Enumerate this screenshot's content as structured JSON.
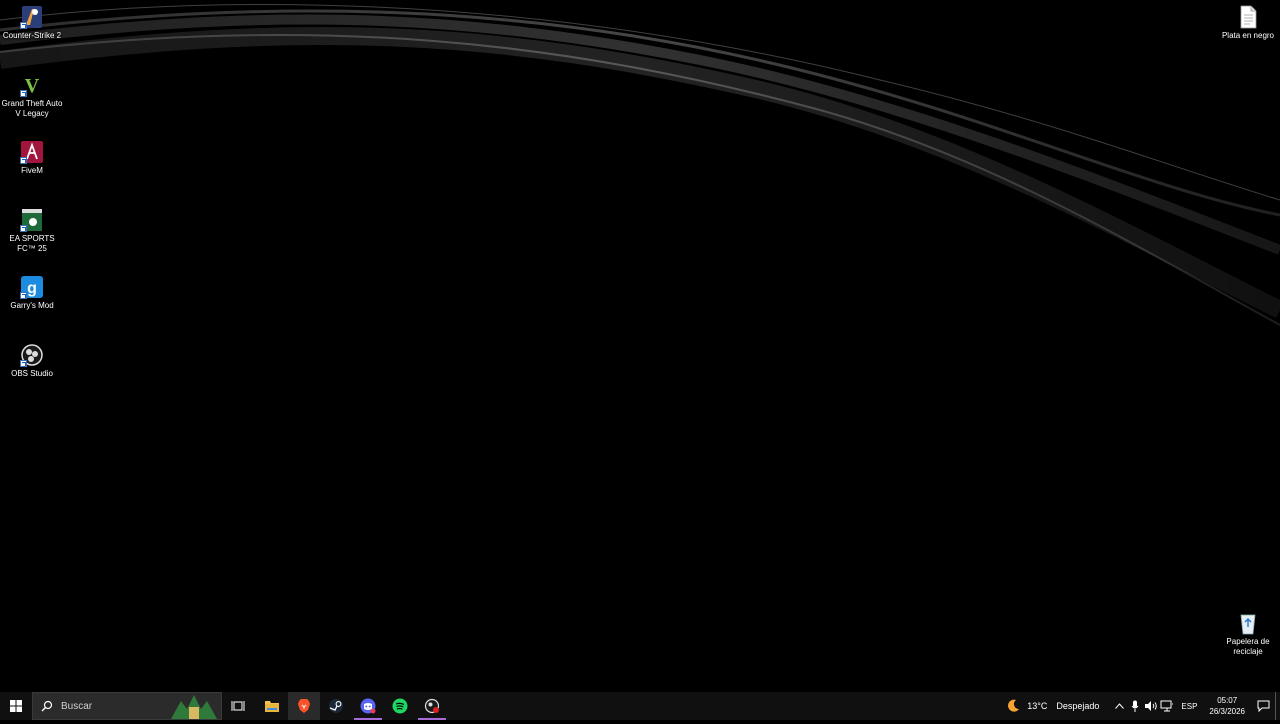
{
  "desktop": {
    "icons_left": [
      {
        "label": "Counter-Strike 2",
        "icon": "counter-strike-icon"
      },
      {
        "label": "Grand Theft Auto V Legacy",
        "icon": "gta-v-icon"
      },
      {
        "label": "FiveM",
        "icon": "fivem-icon"
      },
      {
        "label": "EA SPORTS FC™ 25",
        "icon": "ea-fc-icon"
      },
      {
        "label": "Garry's Mod",
        "icon": "garrys-mod-icon"
      },
      {
        "label": "OBS Studio",
        "icon": "obs-icon"
      }
    ],
    "icons_right": [
      {
        "label": "Plata en negro",
        "icon": "document-icon"
      },
      {
        "label": "Papelera de reciclaje",
        "icon": "recycle-bin-icon"
      }
    ]
  },
  "taskbar": {
    "search_placeholder": "Buscar",
    "pinned": [
      {
        "name": "task-view",
        "icon": "task-view-icon"
      },
      {
        "name": "file-explorer",
        "icon": "folder-icon"
      },
      {
        "name": "brave",
        "icon": "brave-lion-icon",
        "active": true
      },
      {
        "name": "steam",
        "icon": "steam-icon"
      },
      {
        "name": "discord",
        "icon": "discord-icon",
        "running": true
      },
      {
        "name": "spotify",
        "icon": "spotify-icon"
      },
      {
        "name": "obs",
        "icon": "obs-record-icon",
        "running": true
      }
    ],
    "weather": {
      "temp": "13°C",
      "condition": "Despejado",
      "icon": "moon-weather-icon"
    },
    "language": "ESP",
    "time": "05:07",
    "date": "26/3/2026"
  },
  "colors": {
    "taskbar_bg": "#101010",
    "desktop_bg": "#000000",
    "active_indicator": "#a76bd8"
  }
}
